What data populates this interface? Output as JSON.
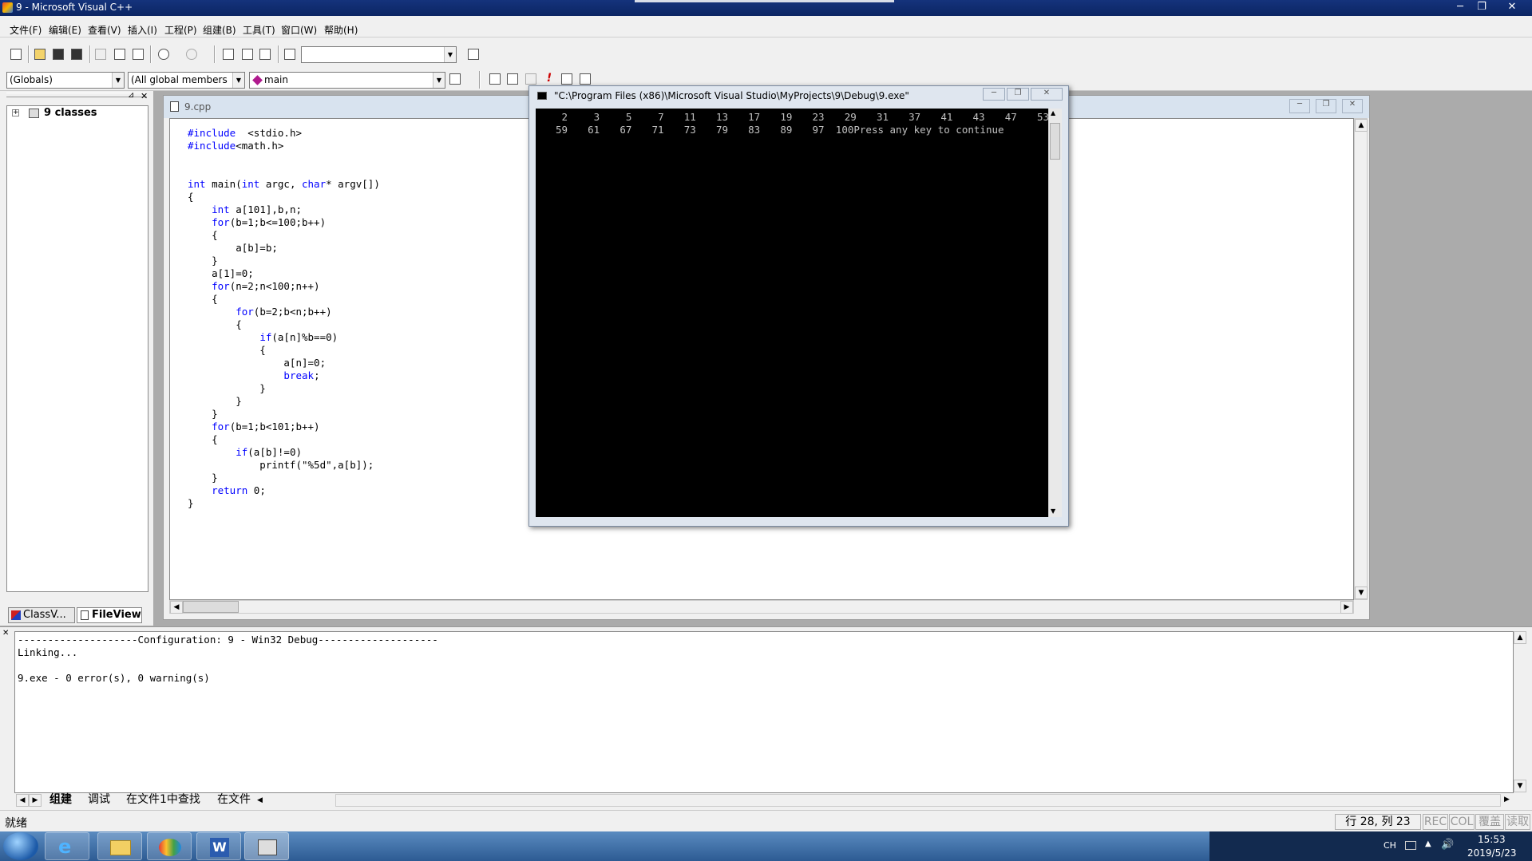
{
  "window": {
    "title": "9 - Microsoft Visual C++",
    "min_glyph": "─",
    "max_glyph": "❐",
    "close_glyph": "✕"
  },
  "menu": [
    "文件(F)",
    "编辑(E)",
    "查看(V)",
    "插入(I)",
    "工程(P)",
    "组建(B)",
    "工具(T)",
    "窗口(W)",
    "帮助(H)"
  ],
  "toolbar": {
    "find_combo_value": "",
    "globals_combo": "(Globals)",
    "members_combo": "(All global members",
    "function_combo": "main"
  },
  "workspace": {
    "tree_root": "9 classes",
    "tabs": [
      "ClassV...",
      "FileView"
    ]
  },
  "editor": {
    "file_tab": "9.cpp",
    "code_lines": [
      [
        [
          "kw",
          "#include"
        ],
        [
          "",
          "  <stdio.h>"
        ]
      ],
      [
        [
          "kw",
          "#include"
        ],
        [
          "",
          "<math.h>"
        ]
      ],
      [],
      [],
      [
        [
          "kw",
          "int"
        ],
        [
          "",
          " main("
        ],
        [
          "kw",
          "int"
        ],
        [
          "",
          " argc, "
        ],
        [
          "kw",
          "char"
        ],
        [
          "",
          "* argv[])"
        ]
      ],
      [
        [
          "",
          "{"
        ]
      ],
      [
        [
          "",
          "    "
        ],
        [
          "kw",
          "int"
        ],
        [
          "",
          " a[101],b,n;"
        ]
      ],
      [
        [
          "",
          "    "
        ],
        [
          "kw",
          "for"
        ],
        [
          "",
          "(b=1;b<=100;b++)"
        ]
      ],
      [
        [
          "",
          "    {"
        ]
      ],
      [
        [
          "",
          "        a[b]=b;"
        ]
      ],
      [
        [
          "",
          "    }"
        ]
      ],
      [
        [
          "",
          "    a[1]=0;"
        ]
      ],
      [
        [
          "",
          "    "
        ],
        [
          "kw",
          "for"
        ],
        [
          "",
          "(n=2;n<100;n++)"
        ]
      ],
      [
        [
          "",
          "    {"
        ]
      ],
      [
        [
          "",
          "        "
        ],
        [
          "kw",
          "for"
        ],
        [
          "",
          "(b=2;b<n;b++)"
        ]
      ],
      [
        [
          "",
          "        {"
        ]
      ],
      [
        [
          "",
          "            "
        ],
        [
          "kw",
          "if"
        ],
        [
          "",
          "(a[n]%b==0)"
        ]
      ],
      [
        [
          "",
          "            {"
        ]
      ],
      [
        [
          "",
          "                a[n]=0;"
        ]
      ],
      [
        [
          "",
          "                "
        ],
        [
          "kw",
          "break"
        ],
        [
          "",
          ";"
        ]
      ],
      [
        [
          "",
          "            }"
        ]
      ],
      [
        [
          "",
          "        }"
        ]
      ],
      [
        [
          "",
          "    }"
        ]
      ],
      [
        [
          "",
          "    "
        ],
        [
          "kw",
          "for"
        ],
        [
          "",
          "(b=1;b<101;b++)"
        ]
      ],
      [
        [
          "",
          "    {"
        ]
      ],
      [
        [
          "",
          "        "
        ],
        [
          "kw",
          "if"
        ],
        [
          "",
          "(a[b]!=0)"
        ]
      ],
      [
        [
          "",
          "            printf(\"%5d\",a[b]);"
        ]
      ],
      [
        [
          "",
          "    }"
        ]
      ],
      [
        [
          "",
          "    "
        ],
        [
          "kw",
          "return"
        ],
        [
          "",
          " 0;"
        ]
      ],
      [
        [
          "",
          "}"
        ]
      ]
    ]
  },
  "console": {
    "title": "\"C:\\Program Files (x86)\\Microsoft Visual Studio\\MyProjects\\9\\Debug\\9.exe\"",
    "line1": [
      "2",
      "3",
      "5",
      "7",
      "11",
      "13",
      "17",
      "19",
      "23",
      "29",
      "31",
      "37",
      "41",
      "43",
      "47",
      "53"
    ],
    "line2": [
      "59",
      "61",
      "67",
      "71",
      "73",
      "79",
      "83",
      "89",
      "97"
    ],
    "line2_tail": "100Press any key to continue"
  },
  "output": {
    "lines": [
      "--------------------Configuration: 9 - Win32 Debug--------------------",
      "Linking...",
      "",
      "9.exe - 0 error(s), 0 warning(s)"
    ],
    "tabs": [
      "组建",
      "调试",
      "在文件1中查找",
      "在文件"
    ]
  },
  "status": {
    "left": "就绪",
    "position": "行 28, 列 23",
    "indicators": [
      "REC",
      "COL",
      "覆盖",
      "读取"
    ]
  },
  "taskbar": {
    "clock_time": "15:53",
    "clock_date": "2019/5/23",
    "lang": "CH"
  }
}
